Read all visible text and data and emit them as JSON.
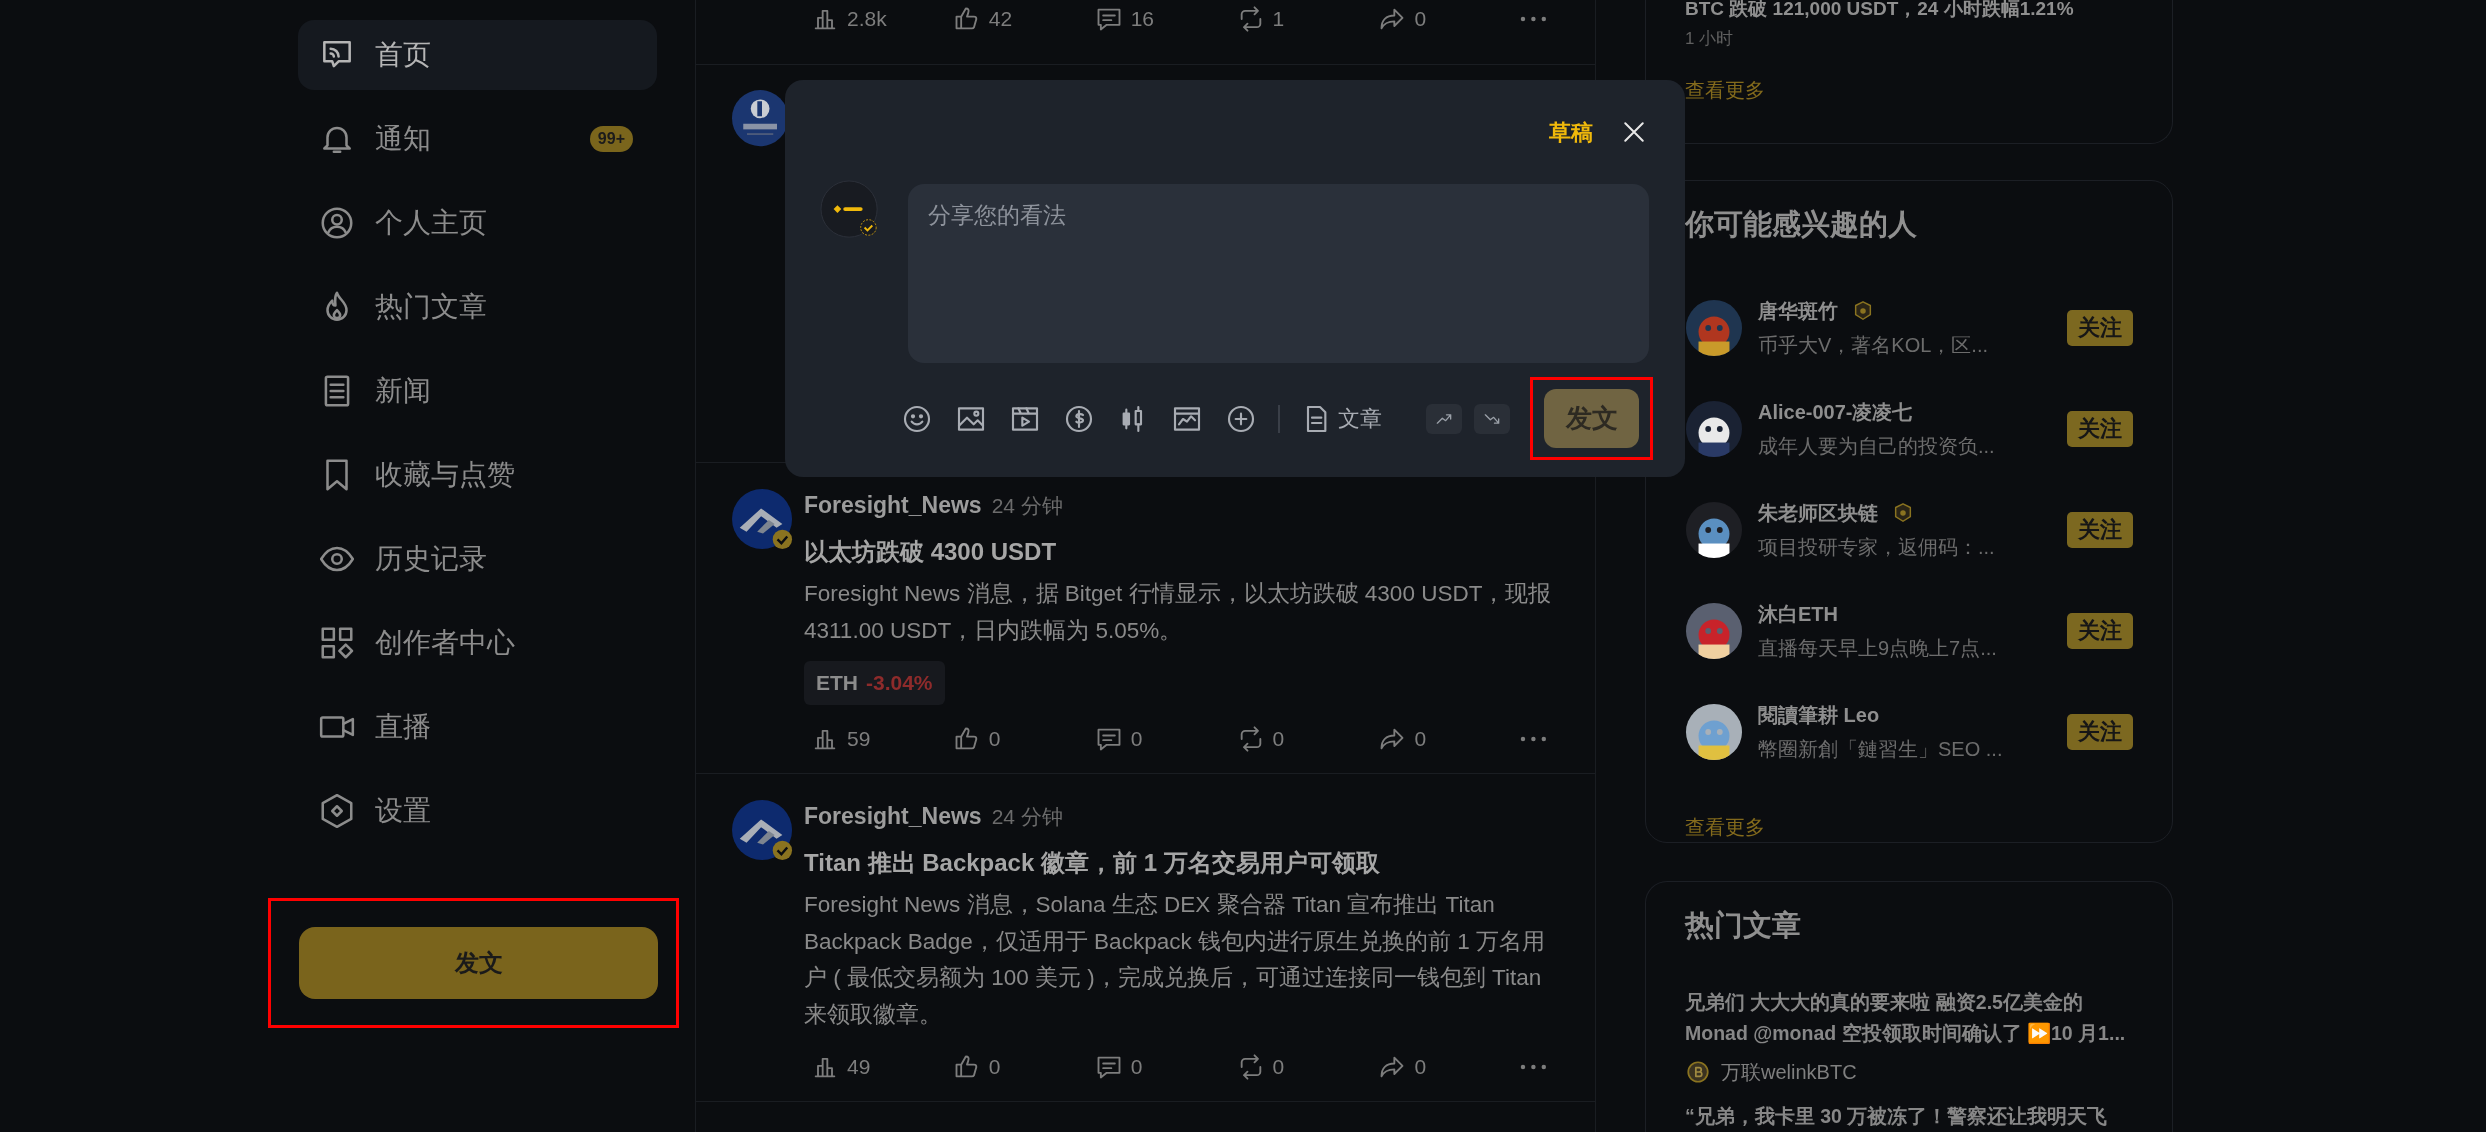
{
  "sidebar": {
    "items": [
      {
        "label": "首页",
        "selected": true
      },
      {
        "label": "通知",
        "selected": false,
        "badge": "99+"
      },
      {
        "label": "个人主页",
        "selected": false
      },
      {
        "label": "热门文章",
        "selected": false
      },
      {
        "label": "新闻",
        "selected": false
      },
      {
        "label": "收藏与点赞",
        "selected": false
      },
      {
        "label": "历史记录",
        "selected": false
      },
      {
        "label": "创作者中心",
        "selected": false
      },
      {
        "label": "直播",
        "selected": false
      },
      {
        "label": "设置",
        "selected": false
      }
    ],
    "post_button": {
      "label": "发文",
      "highlighted": true
    }
  },
  "feed": {
    "posts": [
      {
        "kind": "stats_only",
        "stats": [
          "2.8k",
          "42",
          "16",
          "1",
          "0"
        ]
      },
      {
        "kind": "avatar_only"
      },
      {
        "kind": "full",
        "author": "Foresight_News",
        "time": "24 分钟",
        "title": "以太坊跌破 4300 USDT",
        "body": "Foresight News 消息，据 Bitget 行情显示，以太坊跌破 4300 USDT，现报 4311.00 USDT，日内跌幅为 5.05%。",
        "tag": {
          "symbol": "ETH",
          "change": "-3.04%"
        },
        "stats": [
          "59",
          "0",
          "0",
          "0",
          "0"
        ]
      },
      {
        "kind": "full",
        "author": "Foresight_News",
        "time": "24 分钟",
        "title": "Titan 推出 Backpack 徽章，前 1 万名交易用户可领取",
        "body": "Foresight News 消息，Solana 生态 DEX 聚合器 Titan 宣布推出 Titan Backpack Badge，仅适用于 Backpack 钱包内进行原生兑换的前 1 万名用户 ( 最低交易额为 100 美元 )，完成兑换后，可通过连接同一钱包到 Titan 来领取徽章。",
        "stats": [
          "49",
          "0",
          "0",
          "0",
          "0"
        ]
      }
    ]
  },
  "composer": {
    "draft_link": "草稿",
    "placeholder": "分享您的看法",
    "article_button": "文章",
    "submit": {
      "label": "发文",
      "highlighted": true
    }
  },
  "news_card": {
    "headline": "BTC 跌破 121,000 USDT，24 小时跌幅1.21%",
    "time": "1 小时",
    "more": "查看更多"
  },
  "people_card": {
    "title": "你可能感兴趣的人",
    "people": [
      {
        "name": "唐华斑竹",
        "badge": true,
        "bio": "币乎大V，著名KOL，区...",
        "follow": "关注"
      },
      {
        "name": "Alice-007-凌凌七",
        "badge": false,
        "bio": "成年人要为自己的投资负...",
        "follow": "关注"
      },
      {
        "name": "朱老师区块链",
        "badge": true,
        "bio": "项目投研专家，返佣码：...",
        "follow": "关注"
      },
      {
        "name": "沐白ETH",
        "badge": false,
        "bio": "直播每天早上9点晚上7点...",
        "follow": "关注"
      },
      {
        "name": "閱讀筆耕 Leo",
        "badge": false,
        "bio": "幣圈新創「鏈習生」SEO ...",
        "follow": "关注"
      }
    ],
    "more": "查看更多"
  },
  "hot_card": {
    "title": "热门文章",
    "articles": [
      {
        "title": "兄弟们 大大大的真的要来啦 融资2.5亿美金的 Monad @monad 空投领取时间确认了 ⏩10 月1...",
        "author": "万联welinkBTC"
      },
      {
        "title": "“兄弟，我卡里 30 万被冻了！警察还让我明天飞"
      }
    ]
  }
}
